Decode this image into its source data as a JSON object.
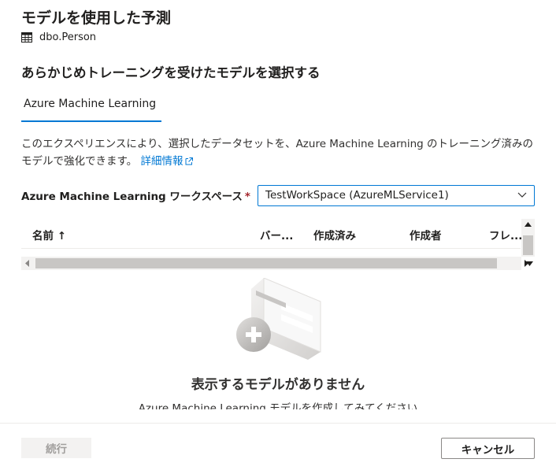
{
  "panel": {
    "title": "モデルを使用した予測",
    "source_table": "dbo.Person",
    "section_heading": "あらかじめトレーニングを受けたモデルを選択する"
  },
  "tabs": [
    {
      "label": "Azure Machine Learning",
      "selected": true
    }
  ],
  "description": {
    "text": "このエクスペリエンスにより、選択したデータセットを、Azure Machine Learning のトレーニング済みのモデルで強化できます。",
    "link_label": "詳細情報"
  },
  "workspace": {
    "label": "Azure Machine Learning ワークスペース",
    "required_mark": "*",
    "selected_value": "TestWorkSpace (AzureMLService1)"
  },
  "models_table": {
    "columns": [
      "名前 ↑",
      "バー...",
      "作成済み",
      "作成者",
      "フレ..."
    ],
    "rows": []
  },
  "empty_state": {
    "title": "表示するモデルがありません",
    "subtitle": "Azure Machine Learning モデルを作成してみてください"
  },
  "footer": {
    "continue_label": "続行",
    "cancel_label": "キャンセル"
  },
  "colors": {
    "accent": "#0078d4",
    "required": "#a4262c",
    "disabled_button": "#f3f2f1"
  },
  "icons": {
    "table_icon": "table-icon",
    "external_link": "external-link-icon",
    "dropdown": "chevron-down-icon"
  }
}
